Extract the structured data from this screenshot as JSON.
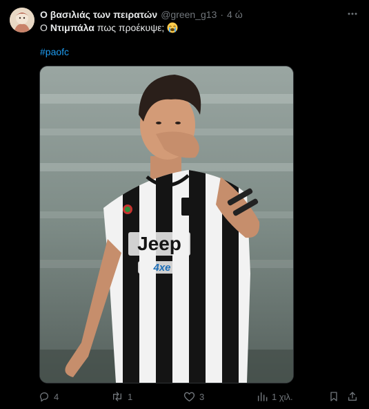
{
  "author": {
    "display_name": "Ο βασιλιάς των πειρατών",
    "handle": "@green_g13",
    "separator": "·",
    "time": "4 ώ"
  },
  "text": {
    "prefix": "Ο",
    "bold_name": "Ντιμπάλα",
    "rest": "πως προέκυψε;",
    "emoji_name": "loudly-crying-face-emoji"
  },
  "hashtag": "#paofc",
  "media": {
    "jersey_sponsor": "Jeep",
    "jersey_badge": "4xe"
  },
  "actions": {
    "replies": "4",
    "reposts": "1",
    "likes": "3",
    "views": "1 χιλ."
  },
  "icons": [
    "more-icon",
    "reply-icon",
    "repost-icon",
    "like-icon",
    "views-icon",
    "bookmark-icon",
    "share-icon"
  ],
  "colors": {
    "accent": "#1d9bf0",
    "muted": "#71767b",
    "text": "#e7e9ea",
    "background": "#000000"
  }
}
